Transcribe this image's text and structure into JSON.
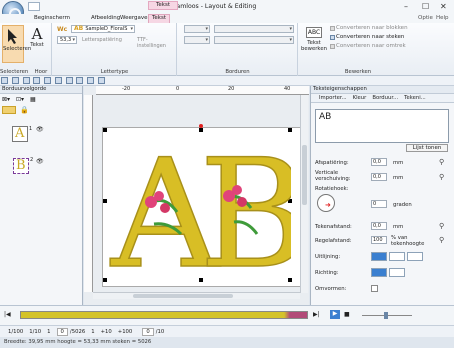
{
  "window": {
    "title": "Naamloos - Layout & Editing",
    "context_tab_group": "Tekst",
    "controls": [
      "–",
      "☐",
      "✕"
    ]
  },
  "tabs": {
    "items": [
      "Beginscherm",
      "Afbeelding",
      "Weergave",
      "Tekst"
    ],
    "active": "Tekst",
    "right": [
      "Optie",
      "Help"
    ]
  },
  "ribbon": {
    "selecteren": {
      "select_label": "Selecteren",
      "tekst_label": "Tekst",
      "group_label": "Selecteren",
      "hoor_label": "Hoor"
    },
    "lettertype": {
      "font_name": "SampleD_FloralS",
      "size": "53,3",
      "letter_type": "Letterspatiëring",
      "tt_settings": "TTF-instellingen",
      "group_label": "Lettertype"
    },
    "borduren": {
      "group_label": "Borduren"
    },
    "bewerken": {
      "abc_label": "ABC",
      "text_edit_label": "Tekst bewerken",
      "convert_blocks": "Converteren naar blokken",
      "convert_stitches": "Converteren naar steken",
      "convert_outline": "Converteren naar omtrek",
      "group_label": "Bewerken"
    }
  },
  "left_panel": {
    "title": "Borduurvolgorde",
    "objects": [
      {
        "label": "A",
        "num": "1"
      },
      {
        "label": "B",
        "num": "2"
      }
    ]
  },
  "canvas": {
    "ruler_marks": [
      "-20",
      "0",
      "20",
      "40"
    ],
    "letters": "AB"
  },
  "right_panel": {
    "title": "Teksteigenschappen",
    "toolbar": [
      "Importer...",
      "Kleur",
      "Borduur...",
      "Tekeni..."
    ],
    "text_value": "AB",
    "list_button": "Lijst tonen",
    "props": [
      {
        "label": "Afspatiëring:",
        "value": "0,0",
        "unit": "mm"
      },
      {
        "label": "Verticale verschuiving:",
        "value": "0,0",
        "unit": "mm"
      },
      {
        "label": "Rotatiehoek:",
        "value": "0",
        "unit": "graden"
      },
      {
        "label": "Tekenafstand:",
        "value": "0,0",
        "unit": "mm"
      },
      {
        "label": "Regelafstand:",
        "value": "100",
        "unit": "% van tekenhoogte"
      },
      {
        "label": "Uitlijning:"
      },
      {
        "label": "Richting:"
      },
      {
        "label": "Omvormen:"
      }
    ]
  },
  "timeline": {
    "prev": "|◀",
    "next": "▶|",
    "stop": "■",
    "play": "▶"
  },
  "bottom_toolbar": {
    "values": [
      "1/100",
      "1/10",
      "1",
      "0",
      "/5026",
      "1",
      "+10",
      "+100",
      "0",
      "/10"
    ]
  },
  "status": {
    "text": "Breedte: 39,95 mm  hoogte = 53,33 mm  steken = 5026"
  },
  "colors": {
    "accent": "#3a7fd0",
    "embroidery_gold": "#d8be25",
    "flower_pink": "#e0447a",
    "leaf_green": "#3f9b3a",
    "context_tab": "#f6d7e4"
  }
}
